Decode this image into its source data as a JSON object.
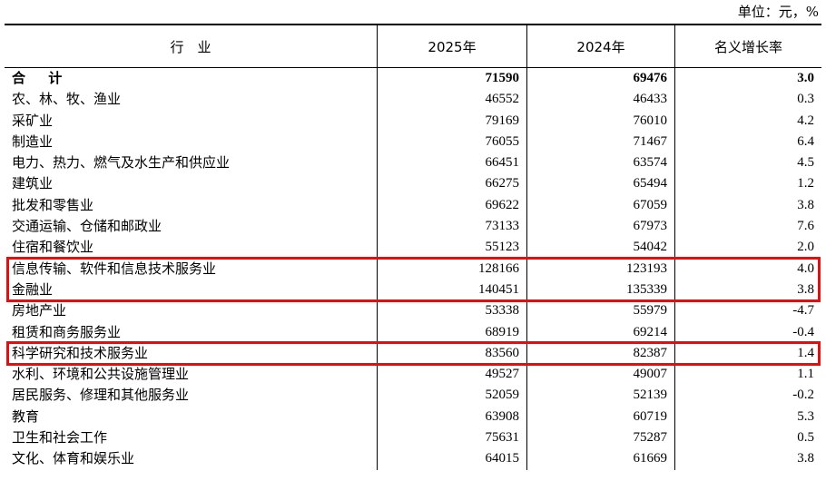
{
  "unit_label": "单位：元，%",
  "headers": {
    "industry": "行　业",
    "year_2025": "2025年",
    "year_2024": "2024年",
    "growth": "名义增长率"
  },
  "rows": [
    {
      "industry": "合 计",
      "v2025": "71590",
      "v2024": "69476",
      "growth": "3.0",
      "total": true
    },
    {
      "industry": "农、林、牧、渔业",
      "v2025": "46552",
      "v2024": "46433",
      "growth": "0.3"
    },
    {
      "industry": "采矿业",
      "v2025": "79169",
      "v2024": "76010",
      "growth": "4.2"
    },
    {
      "industry": "制造业",
      "v2025": "76055",
      "v2024": "71467",
      "growth": "6.4"
    },
    {
      "industry": "电力、热力、燃气及水生产和供应业",
      "v2025": "66451",
      "v2024": "63574",
      "growth": "4.5"
    },
    {
      "industry": "建筑业",
      "v2025": "66275",
      "v2024": "65494",
      "growth": "1.2"
    },
    {
      "industry": "批发和零售业",
      "v2025": "69622",
      "v2024": "67059",
      "growth": "3.8"
    },
    {
      "industry": "交通运输、仓储和邮政业",
      "v2025": "73133",
      "v2024": "67973",
      "growth": "7.6"
    },
    {
      "industry": "住宿和餐饮业",
      "v2025": "55123",
      "v2024": "54042",
      "growth": "2.0"
    },
    {
      "industry": "信息传输、软件和信息技术服务业",
      "v2025": "128166",
      "v2024": "123193",
      "growth": "4.0"
    },
    {
      "industry": "金融业",
      "v2025": "140451",
      "v2024": "135339",
      "growth": "3.8"
    },
    {
      "industry": "房地产业",
      "v2025": "53338",
      "v2024": "55979",
      "growth": "-4.7"
    },
    {
      "industry": "租赁和商务服务业",
      "v2025": "68919",
      "v2024": "69214",
      "growth": "-0.4"
    },
    {
      "industry": "科学研究和技术服务业",
      "v2025": "83560",
      "v2024": "82387",
      "growth": "1.4"
    },
    {
      "industry": "水利、环境和公共设施管理业",
      "v2025": "49527",
      "v2024": "49007",
      "growth": "1.1"
    },
    {
      "industry": "居民服务、修理和其他服务业",
      "v2025": "52059",
      "v2024": "52139",
      "growth": "-0.2"
    },
    {
      "industry": "教育",
      "v2025": "63908",
      "v2024": "60719",
      "growth": "5.3"
    },
    {
      "industry": "卫生和社会工作",
      "v2025": "75631",
      "v2024": "75287",
      "growth": "0.5"
    },
    {
      "industry": "文化、体育和娱乐业",
      "v2025": "64015",
      "v2024": "61669",
      "growth": "3.8"
    }
  ],
  "highlighted_rows": [
    [
      9,
      10
    ],
    [
      13,
      13
    ]
  ],
  "highlight_color": "#e01010"
}
